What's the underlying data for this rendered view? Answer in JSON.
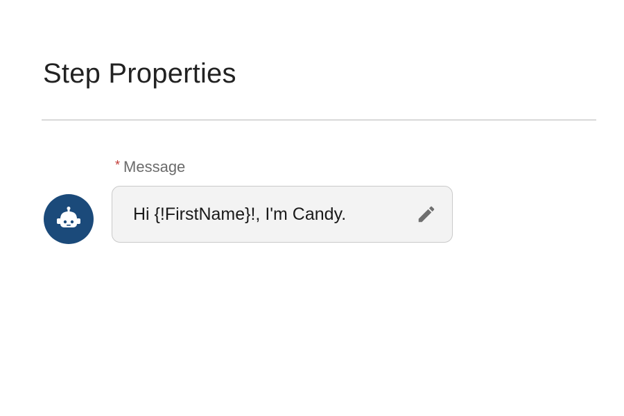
{
  "panel": {
    "title": "Step Properties"
  },
  "message_field": {
    "required_marker": "*",
    "label": "Message",
    "value": "Hi {!FirstName}!, I'm Candy."
  },
  "icons": {
    "avatar": "bot-icon",
    "edit": "pencil-icon"
  },
  "colors": {
    "avatar_background": "#1b4a7a",
    "required_marker": "#c23934",
    "field_background": "#f3f3f3"
  }
}
